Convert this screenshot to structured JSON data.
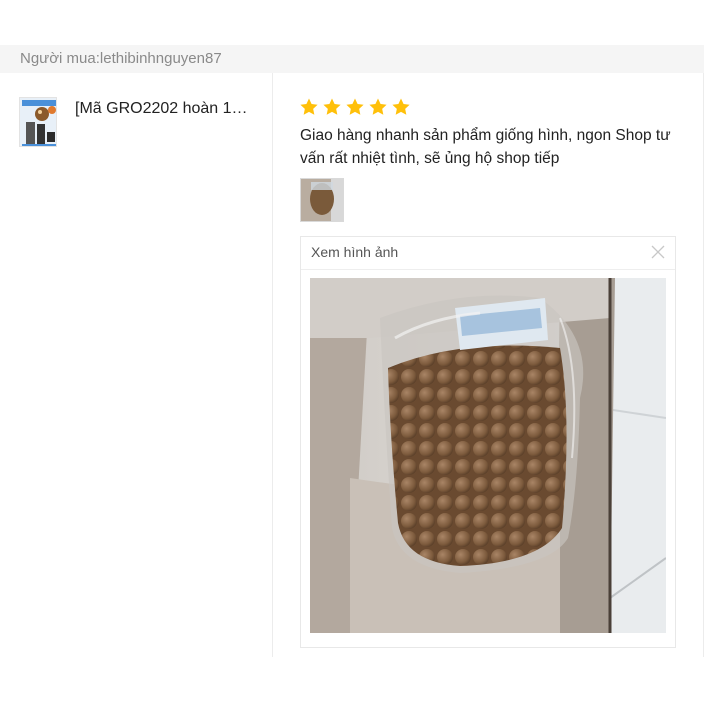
{
  "buyer": {
    "label": "Người mua:lethibinhnguyen87"
  },
  "product": {
    "name": "[Mã GRO2202 hoàn 1…",
    "thumb_icon": "product-thumbnail-image"
  },
  "review": {
    "rating": 5,
    "max_rating": 5,
    "star_color": "#ffc00a",
    "comment": "Giao hàng nhanh sản phẩm giống hình, ngon Shop tư vấn rất nhiệt tình, sẽ ủng hộ shop tiếp"
  },
  "viewer": {
    "title": "Xem hình ảnh",
    "close_icon": "close-icon",
    "photo_icon": "review-photo-image"
  }
}
